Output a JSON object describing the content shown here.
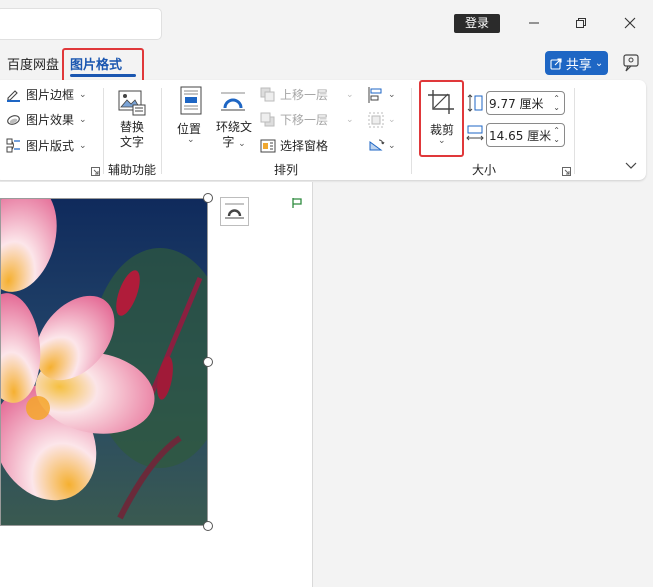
{
  "titlebar": {
    "login_label": "登录",
    "minimize": "—",
    "restore": "❐",
    "close": "✕"
  },
  "tabs": {
    "baidu": "百度网盘",
    "picture_format": "图片格式"
  },
  "share": {
    "label": "共享",
    "caret": "⌄"
  },
  "ribbon": {
    "picture_styles": {
      "border": "图片边框",
      "effects": "图片效果",
      "layout": "图片版式"
    },
    "accessibility": {
      "alt_text_line1": "替换",
      "alt_text_line2": "文字",
      "group_label": "辅助功能"
    },
    "arrange": {
      "position": "位置",
      "wrap_text_line1": "环绕文",
      "wrap_text_line2": "字",
      "bring_forward": "上移一层",
      "send_backward": "下移一层",
      "selection_pane": "选择窗格",
      "group_label": "排列"
    },
    "size": {
      "crop": "裁剪",
      "height_value": "9.77 厘米",
      "width_value": "14.65 厘米",
      "group_label": "大小"
    }
  },
  "colors": {
    "accent_blue": "#1e66c4",
    "highlight_red": "#e0383a",
    "tab_text_blue": "#1a56b0"
  },
  "icons": [
    "search-icon",
    "minimize-icon",
    "restore-icon",
    "close-icon",
    "share-icon",
    "feedback-icon",
    "picture-border-icon",
    "picture-effects-icon",
    "picture-layout-icon",
    "alt-text-icon",
    "position-icon",
    "wrap-text-icon",
    "bring-forward-icon",
    "send-backward-icon",
    "selection-pane-icon",
    "align-icon",
    "group-icon",
    "rotate-icon",
    "crop-icon",
    "height-icon",
    "width-icon",
    "layout-options-icon",
    "anchor-icon"
  ]
}
